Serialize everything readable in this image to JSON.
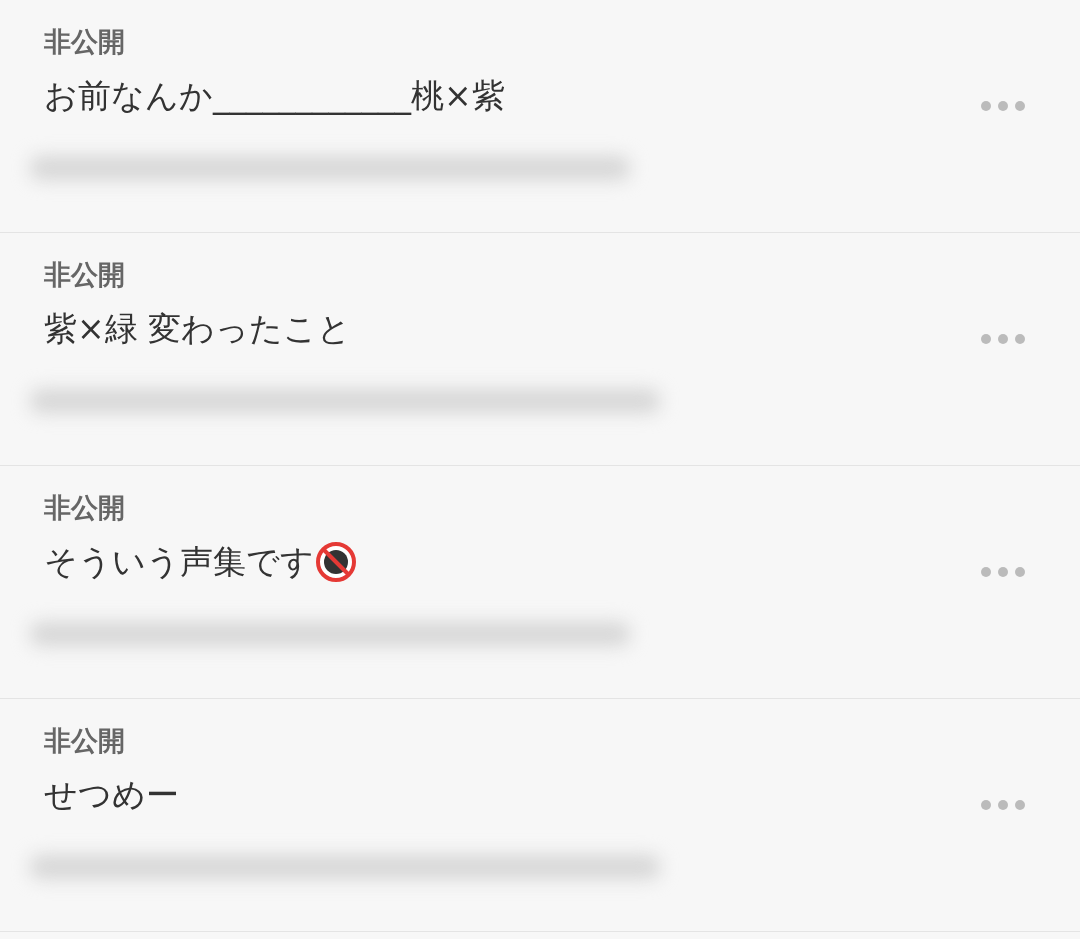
{
  "items": [
    {
      "visibility": "非公開",
      "title": "お前なんか____________桃×紫",
      "adult_badge": false
    },
    {
      "visibility": "非公開",
      "title": "紫×緑 変わったこと",
      "adult_badge": false
    },
    {
      "visibility": "非公開",
      "title": "そういう声集です",
      "adult_badge": true
    },
    {
      "visibility": "非公開",
      "title": "せつめー",
      "adult_badge": false
    }
  ]
}
